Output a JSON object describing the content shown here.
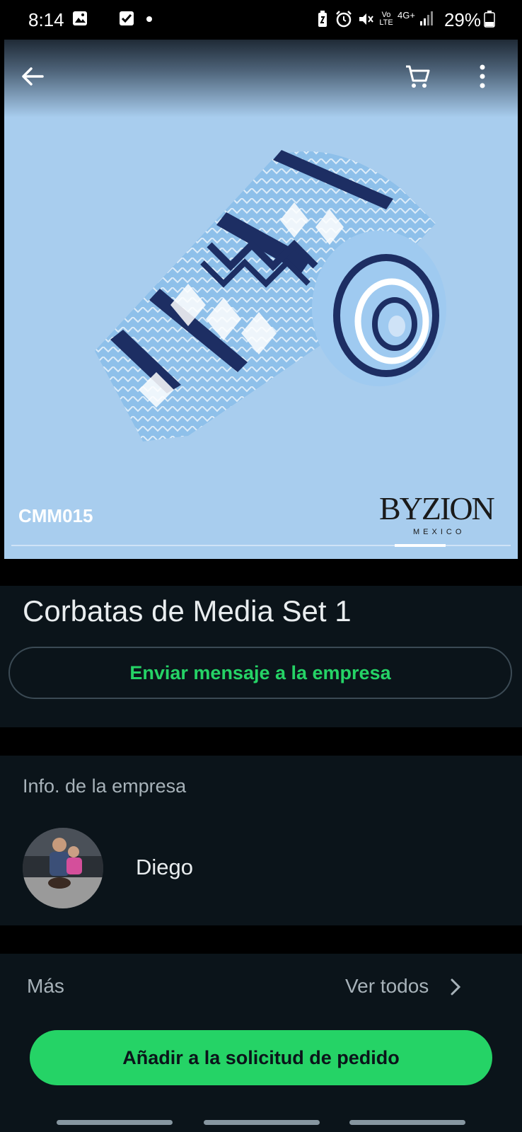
{
  "status_bar": {
    "time": "8:14",
    "battery": "29%",
    "icons": [
      "image-icon",
      "check-box-icon",
      "dot-icon",
      "battery-saver-icon",
      "alarm-icon",
      "mute-icon",
      "volte-icon",
      "4g-data-icon",
      "signal-icon",
      "battery-icon"
    ],
    "volte_label": "Vo LTE",
    "network_label": "4G+"
  },
  "product": {
    "sku": "CMM015",
    "brand_name": "BYZION",
    "brand_sub": "MEXICO",
    "image_count_active_index": 8,
    "title": "Corbatas de Media Set 1",
    "image_background": "#a8cdee"
  },
  "actions": {
    "message_business": "Enviar mensaje a la empresa",
    "add_to_order": "Añadir a la solicitud de pedido"
  },
  "business_info": {
    "heading": "Info. de la empresa",
    "owner_name": "Diego"
  },
  "more": {
    "label": "Más",
    "see_all": "Ver todos"
  },
  "colors": {
    "accent": "#25d366",
    "panel": "#0b141a",
    "muted_text": "#a7b2b9"
  }
}
